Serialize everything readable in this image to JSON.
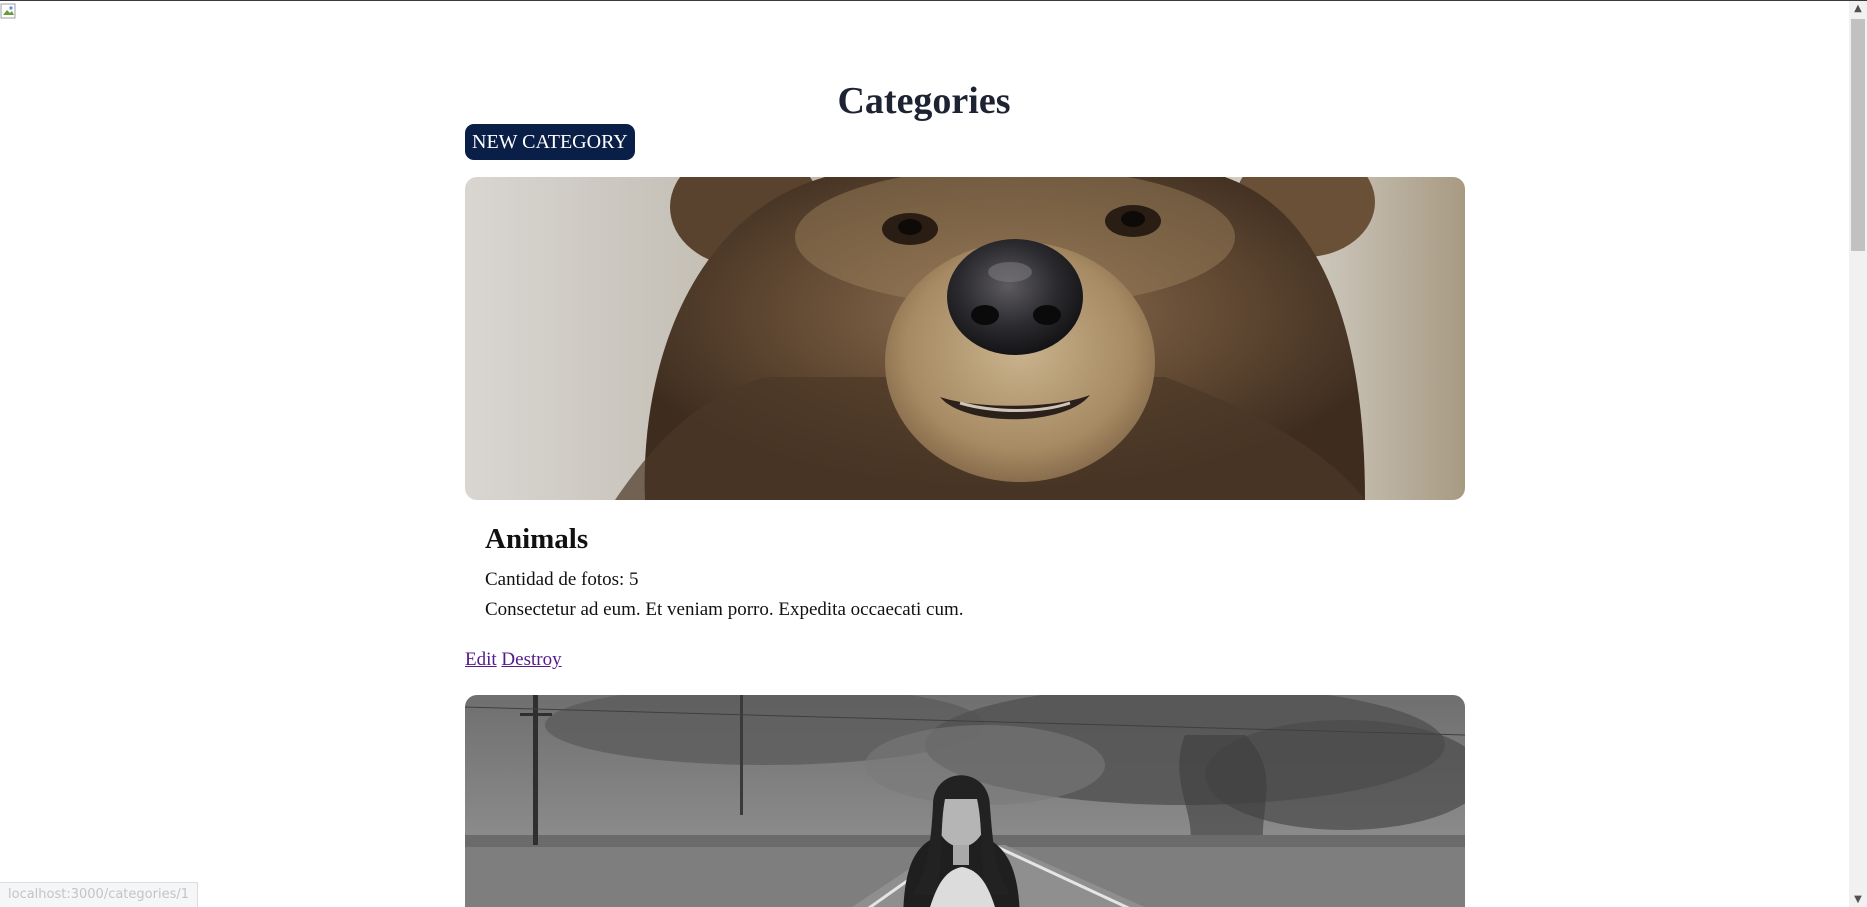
{
  "page": {
    "title": "Categories",
    "new_button_label": "NEW CATEGORY"
  },
  "categories": [
    {
      "name": "Animals",
      "count_text": "Cantidad de fotos: 5",
      "description": "Consectetur ad eum. Et veniam porro. Expedita occaecati cum.",
      "edit_label": "Edit",
      "destroy_label": "Destroy",
      "image_icon": "bear-photo"
    },
    {
      "image_icon": "woman-on-road-photo"
    }
  ],
  "status_bar": {
    "url": "localhost:3000/categories/1"
  },
  "icons": {
    "broken_image": "broken-image-icon",
    "scroll_up": "▲",
    "scroll_down": "▼"
  },
  "colors": {
    "button_bg": "#0a1f48",
    "link_visited": "#551a8b",
    "title": "#1d2333"
  }
}
